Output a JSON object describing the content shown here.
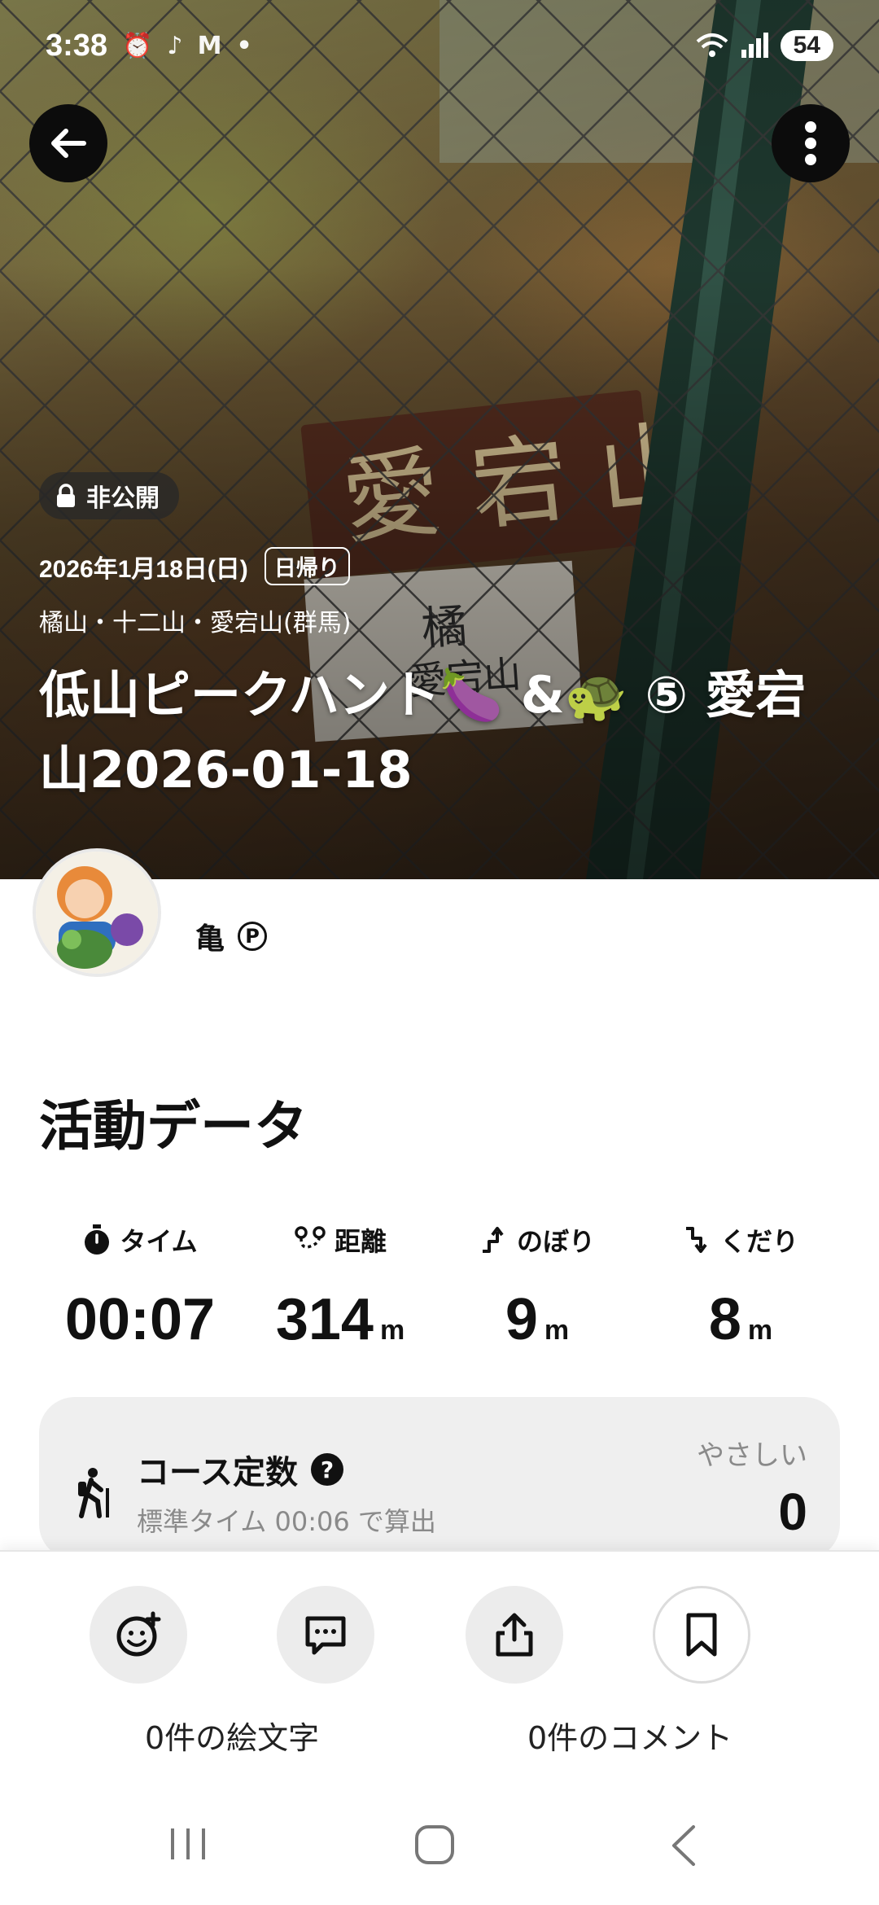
{
  "status_bar": {
    "time": "3:38",
    "battery": "54",
    "icons": [
      "alarm-icon",
      "tiktok-icon",
      "gmail-icon",
      "dot-icon",
      "wifi-icon",
      "signal-icon"
    ]
  },
  "hero": {
    "privacy_label": "非公開",
    "date": "2026年1月18日(日)",
    "trip_type": "日帰り",
    "area": "橘山・十二山・愛宕山(群馬)",
    "title": "低山ピークハント🍆 &🐢 ⑤ 愛宕山2026-01-18"
  },
  "user": {
    "name": "亀",
    "badge": "P"
  },
  "activity": {
    "section_title": "活動データ",
    "stats": [
      {
        "label": "タイム",
        "value": "00:07",
        "unit": "",
        "icon": "stopwatch-icon"
      },
      {
        "label": "距離",
        "value": "314",
        "unit": "m",
        "icon": "route-icon"
      },
      {
        "label": "のぼり",
        "value": "9",
        "unit": "m",
        "icon": "ascent-icon"
      },
      {
        "label": "くだり",
        "value": "8",
        "unit": "m",
        "icon": "descent-icon"
      }
    ],
    "course": {
      "title": "コース定数",
      "subtitle": "標準タイム 00:06 で算出",
      "level": "やさしい",
      "value": "0"
    }
  },
  "actions": {
    "emoji_count_label": "0件の絵文字",
    "comment_count_label": "0件のコメント"
  },
  "colors": {
    "accent_dark": "#111111",
    "card_bg": "#efefef",
    "muted_text": "#8a8a8a"
  }
}
